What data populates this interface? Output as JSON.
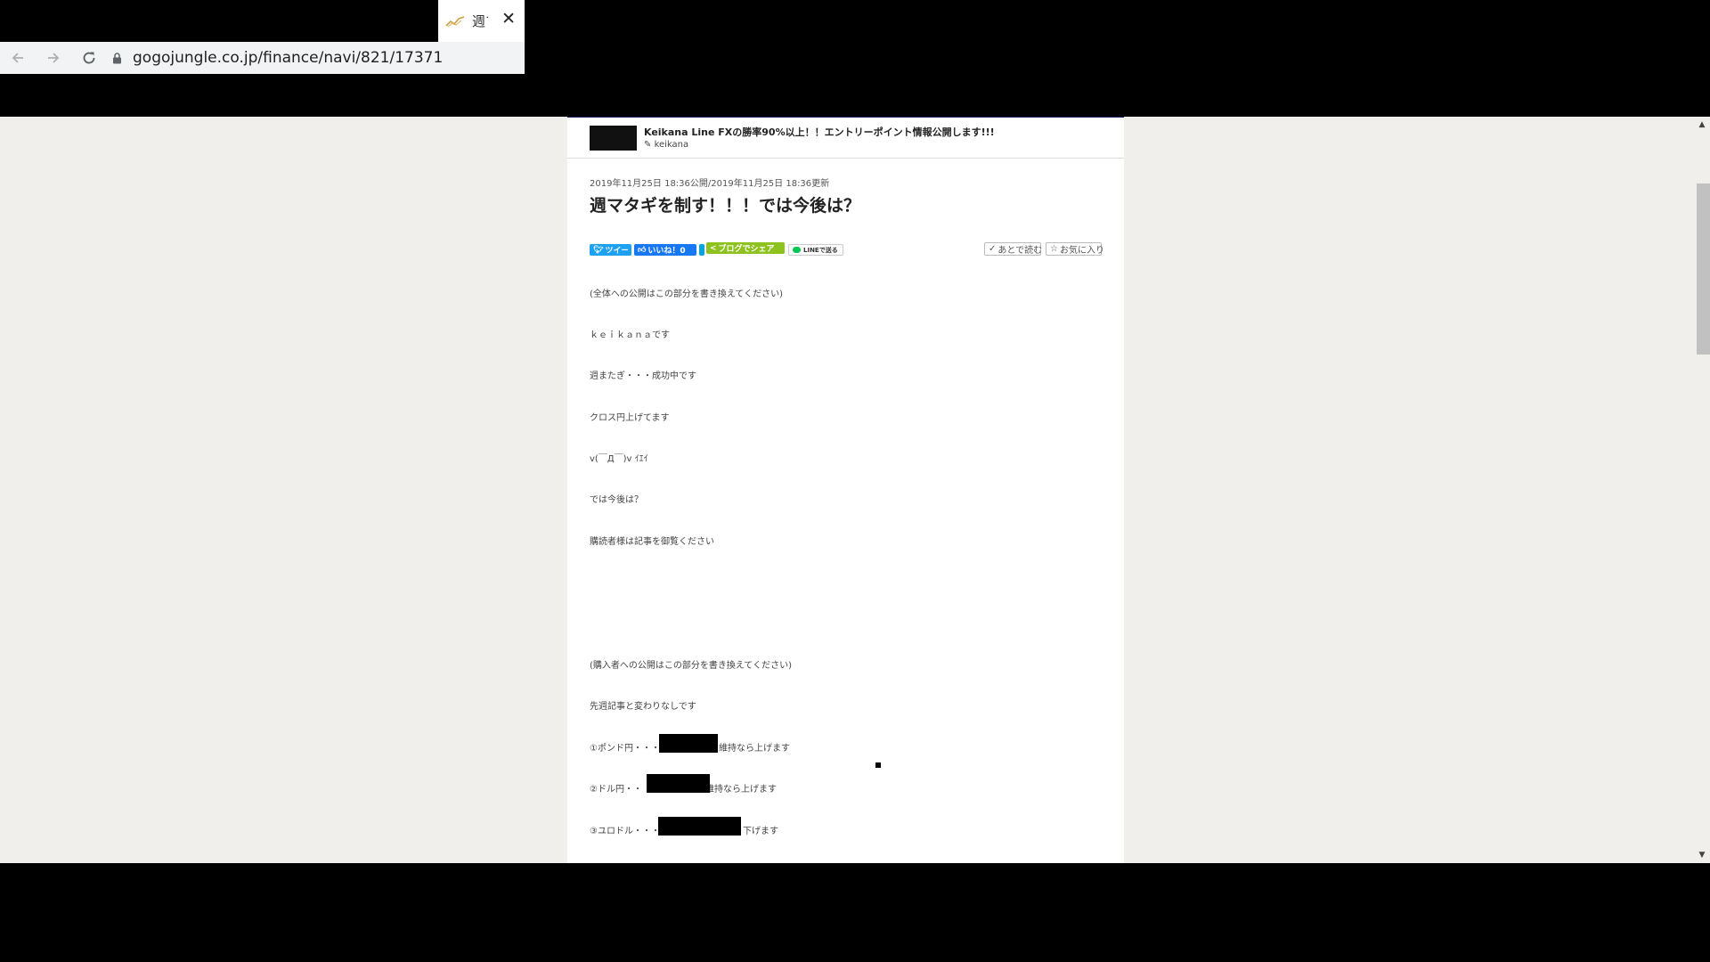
{
  "browser": {
    "tab_title": "週マ",
    "url": "gogojungle.co.jp/finance/navi/821/17371"
  },
  "shop": {
    "title": "Keikana Line FXの勝率90%以上！！エントリーポイント情報公開します!!!",
    "author": "keikana"
  },
  "article": {
    "date": "2019年11月25日 18:36公開/2019年11月25日 18:36更新",
    "title": "週マタギを制す！！！では今後は？",
    "share": {
      "tweet": "ツイート",
      "like": "いいね！0",
      "blog": "ブログでシェア",
      "line": "LINEで送る",
      "read_later": "あとで読む",
      "favorite": "お気に入り"
    },
    "paragraphs": [
      "(全体への公開はこの部分を書き換えてください)",
      "ｋｅｉｋａｎａです",
      "週またぎ・・・成功中です",
      "クロス円上げてます",
      "v(￣Д￣)v ｲｴｲ",
      "では今後は？",
      "購読者様は記事を御覧ください",
      "(購入者への公開はこの部分を書き換えてください)",
      "先週記事と変わりなしです"
    ],
    "items": [
      {
        "prefix": "①ポンド円・・・",
        "suffix": "維持なら上げます"
      },
      {
        "prefix": "②ドル円・・",
        "suffix": "維持なら上げます"
      },
      {
        "prefix": "③ユロドル・・・",
        "suffix": "下げます"
      }
    ]
  },
  "icons": {
    "back": "arrow-left-icon",
    "forward": "arrow-right-icon",
    "reload": "reload-icon",
    "lock": "lock-icon",
    "close": "close-icon"
  }
}
